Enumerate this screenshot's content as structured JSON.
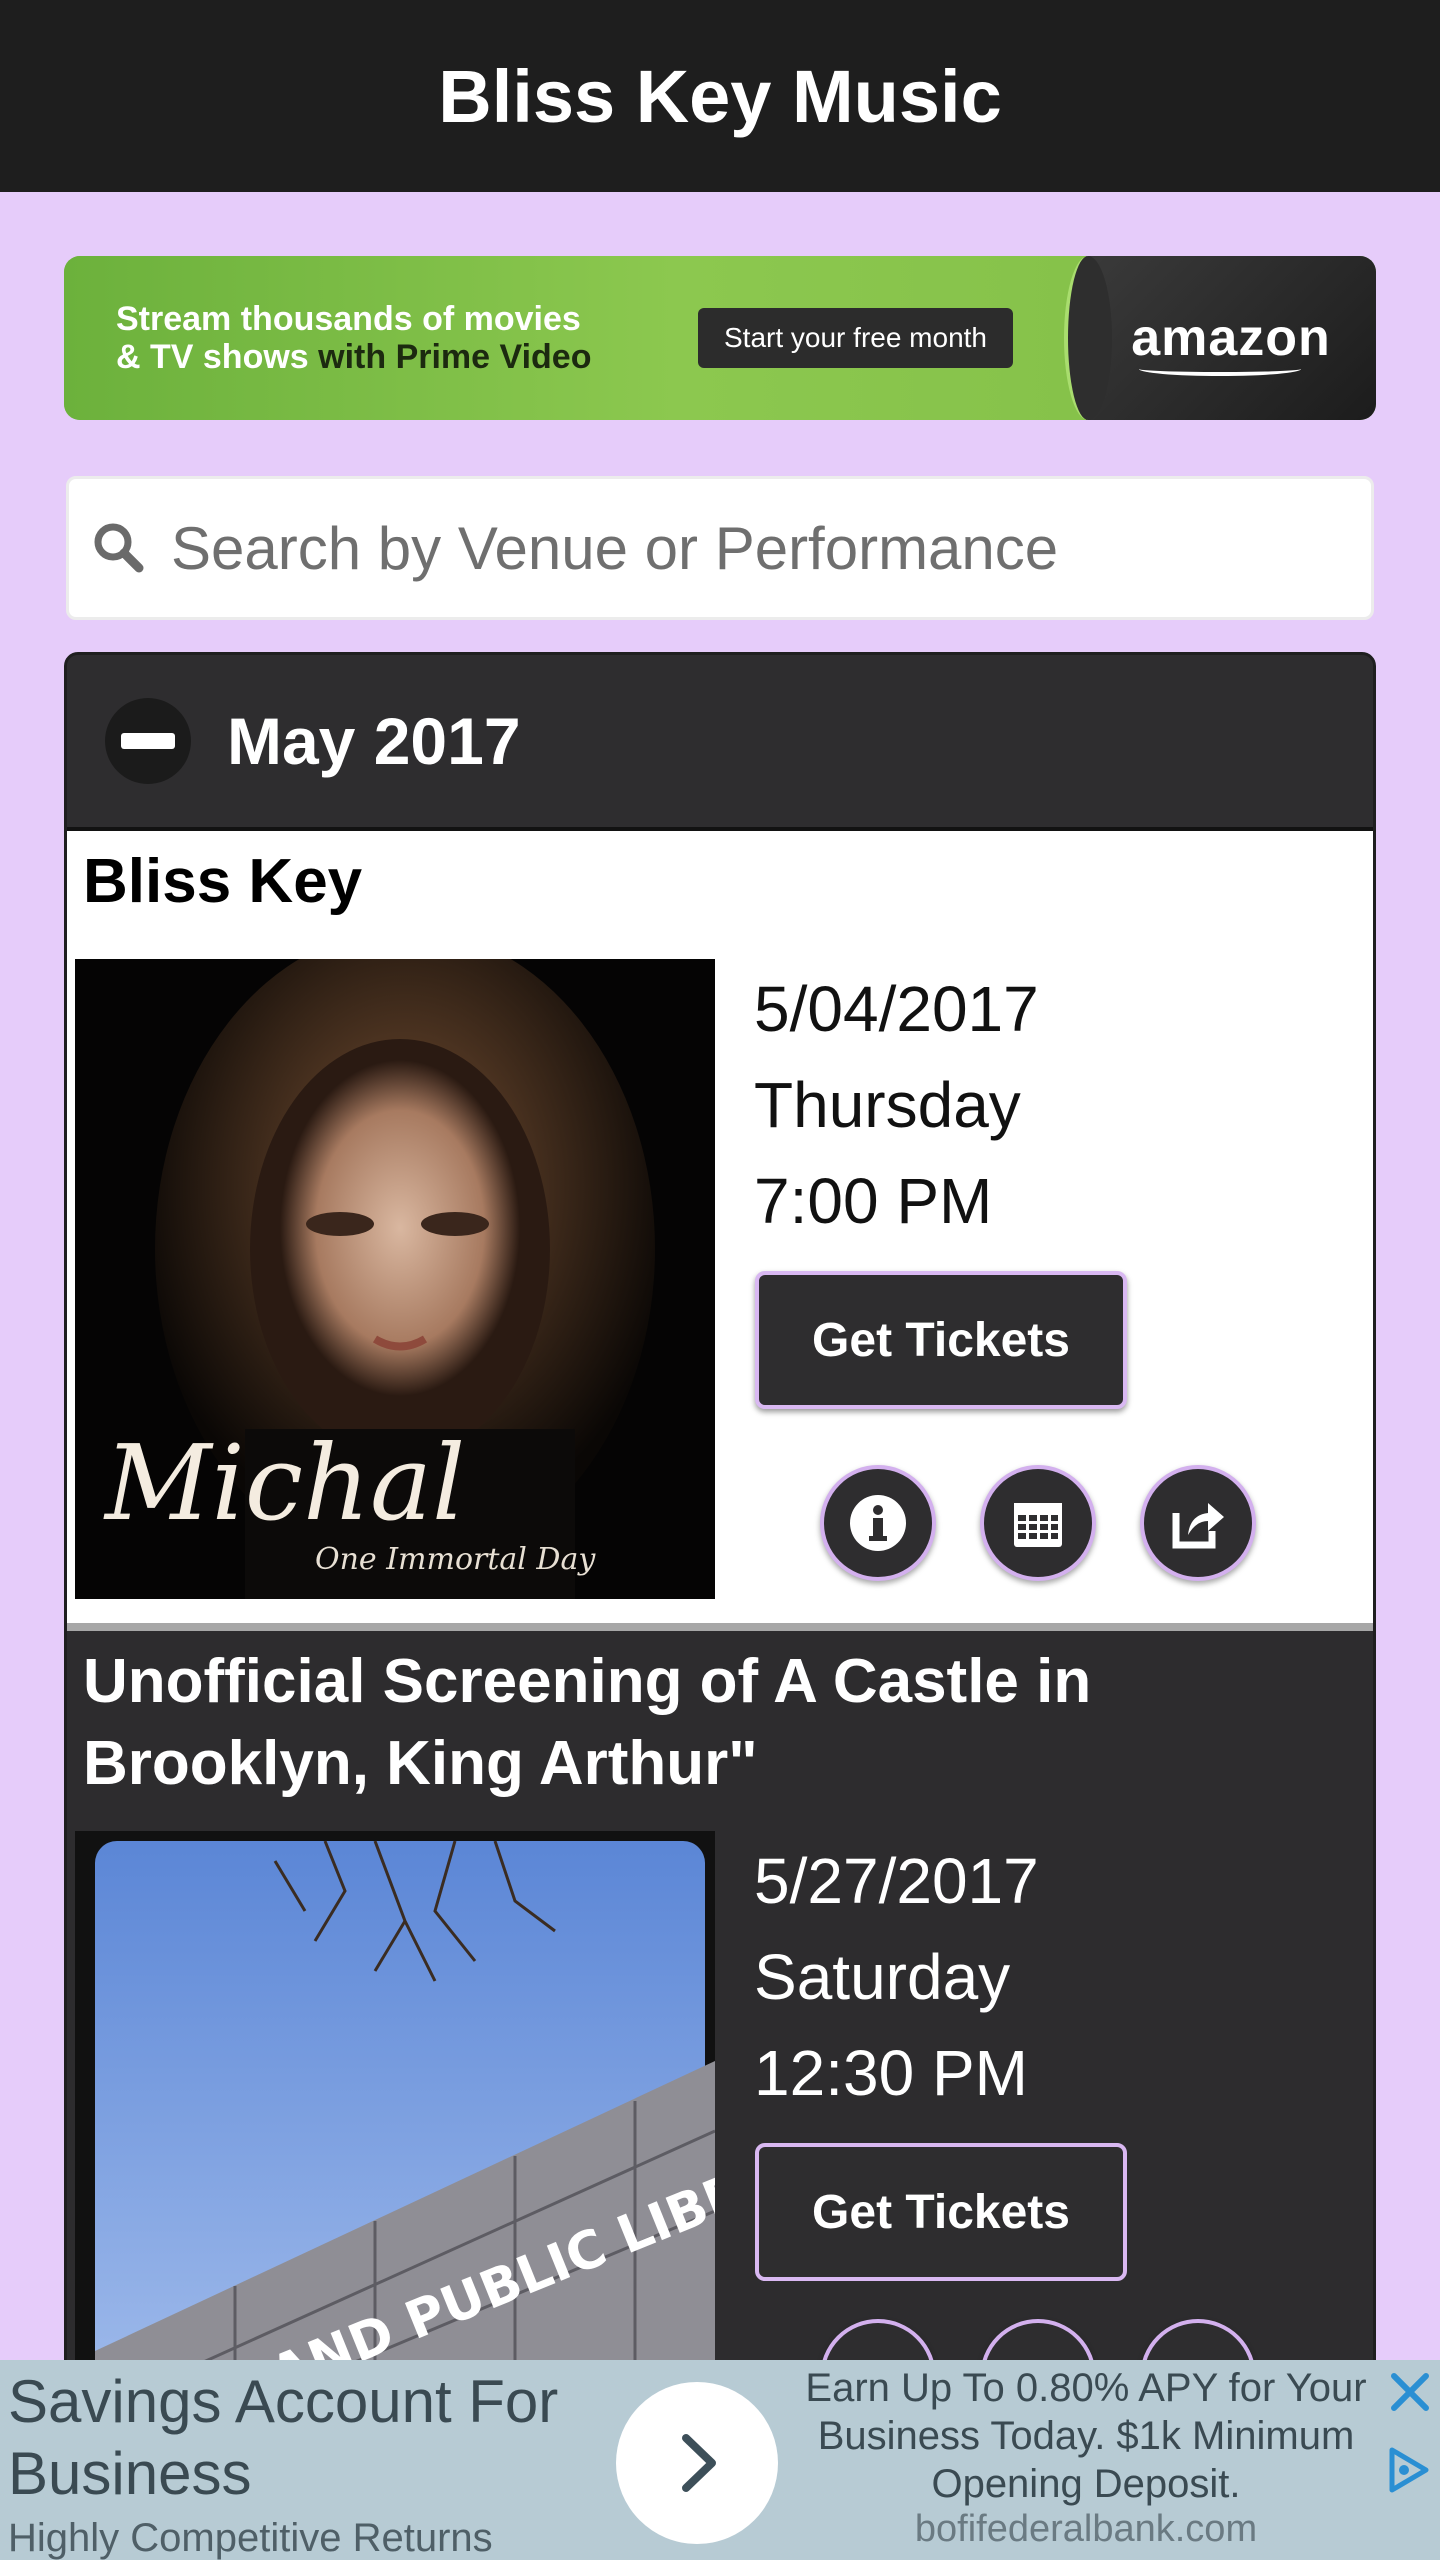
{
  "app": {
    "title": "Bliss Key Music"
  },
  "banner_ad": {
    "line1": "Stream thousands of movies",
    "line2_a": "& TV shows ",
    "line2_b": "with Prime Video",
    "cta": "Start your free month",
    "brand": "amazon",
    "accent_color": "#8cc84f"
  },
  "search": {
    "placeholder": "Search by Venue or Performance",
    "value": ""
  },
  "month": {
    "label": "May 2017",
    "events": [
      {
        "title": "Bliss Key",
        "date": "5/04/2017",
        "day": "Thursday",
        "time": "7:00 PM",
        "tickets_label": "Get Tickets",
        "image_caption": "Michal",
        "image_subcaption": "One Immortal Day",
        "actions": [
          "info-icon",
          "calendar-icon",
          "share-icon"
        ]
      },
      {
        "title": "Unofficial Screening of A Castle in Brooklyn, King Arthur\"",
        "date": "5/27/2017",
        "day": "Saturday",
        "time": "12:30 PM",
        "tickets_label": "Get Tickets",
        "image_caption": "HOWLAND PUBLIC LIBRARY"
      }
    ]
  },
  "bottom_ad": {
    "headline": "Savings Account For Business",
    "subline": "Highly Competitive Returns",
    "body": "Earn Up To 0.80% APY for Your Business Today. $1k Minimum Opening Deposit.",
    "domain": "bofifederalbank.com"
  },
  "colors": {
    "page_background": "#e6ccfa",
    "app_bar": "#1e1e1e",
    "panel": "#2e2d2f",
    "button_border": "#d9b8f2",
    "ad_background": "#b7cbd4"
  }
}
